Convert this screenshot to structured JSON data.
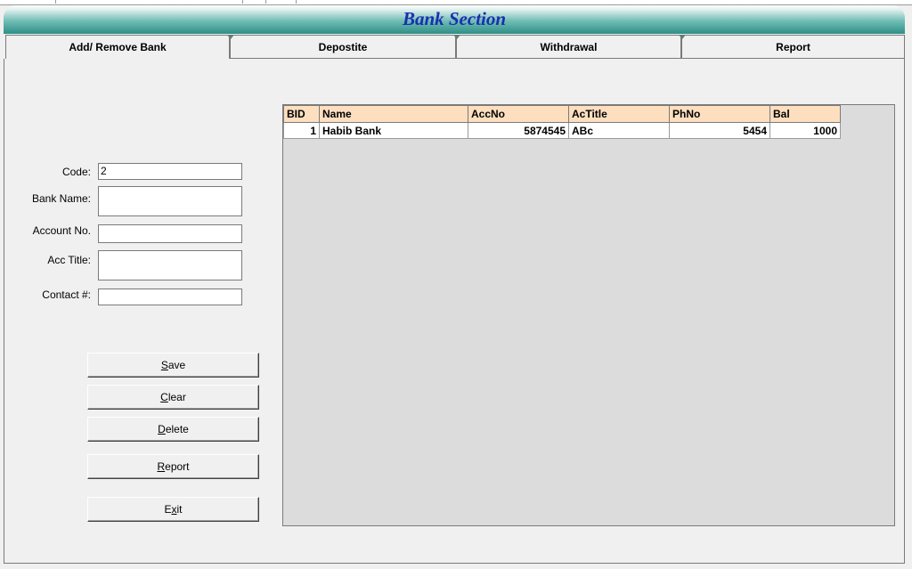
{
  "window": {
    "title": "Bank Section"
  },
  "tabs": [
    {
      "label": "Add/ Remove Bank",
      "active": true
    },
    {
      "label": "Depostite",
      "active": false
    },
    {
      "label": "Withdrawal",
      "active": false
    },
    {
      "label": "Report",
      "active": false
    }
  ],
  "form": {
    "code": {
      "label": "Code:",
      "value": "2"
    },
    "bank_name": {
      "label": "Bank Name:",
      "value": ""
    },
    "account_no": {
      "label": "Account No.",
      "value": ""
    },
    "acc_title": {
      "label": "Acc Title:",
      "value": ""
    },
    "contact": {
      "label": "Contact #:",
      "value": ""
    }
  },
  "buttons": {
    "save": {
      "accel": "S",
      "rest": "ave"
    },
    "clear": {
      "accel": "C",
      "rest": "lear"
    },
    "delete": {
      "accel": "D",
      "rest": "elete"
    },
    "report": {
      "accel": "R",
      "rest": "eport"
    },
    "exit": {
      "pre": "E",
      "accel": "x",
      "rest": "it"
    }
  },
  "grid": {
    "columns": [
      "BID",
      "Name",
      "AccNo",
      "AcTitle",
      "PhNo",
      "Bal"
    ],
    "rows": [
      [
        "1",
        "Habib Bank",
        "5874545",
        "ABc",
        "5454",
        "1000"
      ]
    ]
  },
  "colors": {
    "title_text": "#1a2fb0",
    "header_bg": "#fddfc0",
    "titlebar_teal": "#2e8f86"
  }
}
